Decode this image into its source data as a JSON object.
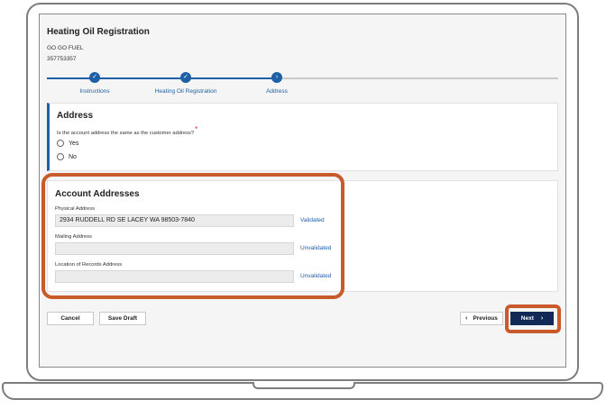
{
  "header": {
    "title": "Heating Oil Registration",
    "account_name": "GO GO FUEL",
    "account_id": "357753357"
  },
  "stepper": {
    "steps": [
      {
        "label": "Instructions",
        "icon": "check-icon"
      },
      {
        "label": "Heating Oil Registration",
        "icon": "check-icon"
      },
      {
        "label": "Address",
        "icon": "arrow-right-icon"
      }
    ]
  },
  "address_section": {
    "title": "Address",
    "question": "Is the account address the same as the customer address?",
    "required_marker": "*",
    "options": [
      "Yes",
      "No"
    ]
  },
  "account_addresses": {
    "title": "Account Addresses",
    "fields": [
      {
        "label": "Physical Address",
        "value": "2934 RUDDELL RD SE LACEY WA 98503-7840",
        "status": "Validated"
      },
      {
        "label": "Mailing Address",
        "value": "",
        "status": "Unvalidated"
      },
      {
        "label": "Location of Records Address",
        "value": "",
        "status": "Unvalidated"
      }
    ]
  },
  "actions": {
    "cancel": "Cancel",
    "save_draft": "Save Draft",
    "previous": "Previous",
    "next": "Next",
    "previous_icon": "‹",
    "next_icon": "›"
  },
  "colors": {
    "primary": "#1f5fa5",
    "next_button": "#102a55",
    "highlight": "#c95a2a",
    "required": "#d92b2b"
  }
}
